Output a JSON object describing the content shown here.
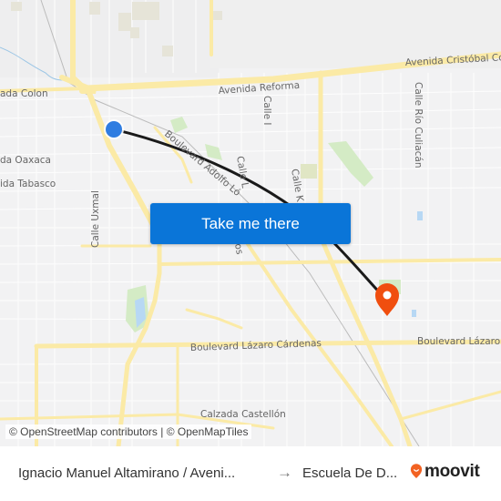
{
  "map": {
    "streets": [
      {
        "label": "Avenida Cristóbal Co",
        "rot": -3
      },
      {
        "label": "Avenida Reforma",
        "rot": -4
      },
      {
        "label": "ada Colon",
        "rot": 0
      },
      {
        "label": "da Oaxaca",
        "rot": 0
      },
      {
        "label": "ida Tabasco",
        "rot": 0
      },
      {
        "label": "Calle Uxmal",
        "rot": -90
      },
      {
        "label": "Boulevard Adolfo Ló",
        "rot": 58
      },
      {
        "label": "Calle I",
        "rot": 90
      },
      {
        "label": "Calle L",
        "rot": 80
      },
      {
        "label": "Calle K",
        "rot": 80
      },
      {
        "label": "Calle Río Culiacán",
        "rot": 90
      },
      {
        "label": "Boulevard Lázaro Cárdenas",
        "rot": -2
      },
      {
        "label": "Boulevard Lázaro",
        "rot": 0
      },
      {
        "label": "Calzada Castellón",
        "rot": 0
      },
      {
        "label": "os",
        "rot": 80
      }
    ],
    "origin_marker": {
      "color": "#2f7de1"
    },
    "destination_marker": {
      "color": "#f04e0f"
    },
    "route_color": "#1a1a1a",
    "take_me_there_label": "Take me there",
    "attribution": "© OpenStreetMap contributors | © OpenMapTiles"
  },
  "footer": {
    "from": "Ignacio Manuel Altamirano / Aveni...",
    "arrow": "→",
    "to": "Escuela De D...",
    "brand": "moovit",
    "brand_color": "#f26222"
  }
}
